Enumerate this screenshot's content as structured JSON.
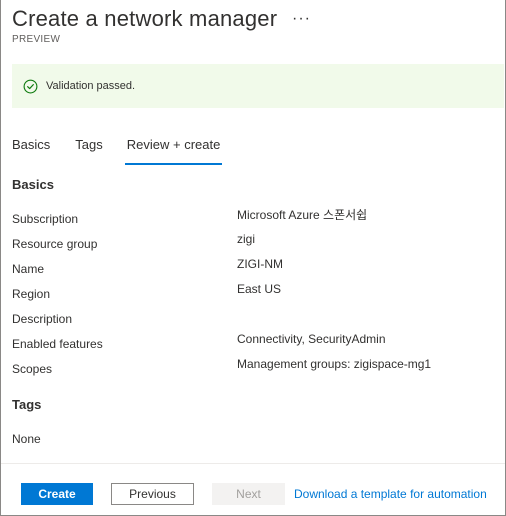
{
  "header": {
    "title": "Create a network manager",
    "more": "···",
    "subtitle": "PREVIEW"
  },
  "banner": {
    "message": "Validation passed.",
    "color": "#f1faea",
    "icon": "check-circle-icon"
  },
  "tabs": [
    {
      "label": "Basics"
    },
    {
      "label": "Tags"
    },
    {
      "label": "Review + create"
    }
  ],
  "active_tab": "Review + create",
  "basics": {
    "title": "Basics",
    "rows": [
      {
        "label": "Subscription",
        "value": "Microsoft Azure 스폰서쉽"
      },
      {
        "label": "Resource group",
        "value": "zigi"
      },
      {
        "label": "Name",
        "value": "ZIGI-NM"
      },
      {
        "label": "Region",
        "value": "East US"
      },
      {
        "label": "Description",
        "value": ""
      },
      {
        "label": "Enabled features",
        "value": "Connectivity, SecurityAdmin"
      },
      {
        "label": "Scopes",
        "value": "Management groups: zigispace-mg1"
      }
    ]
  },
  "tags": {
    "title": "Tags",
    "empty": "None"
  },
  "footer": {
    "create": "Create",
    "previous": "Previous",
    "next": "Next",
    "download": "Download a template for automation"
  },
  "colors": {
    "accent": "#0078d4",
    "success": "#107c10"
  }
}
